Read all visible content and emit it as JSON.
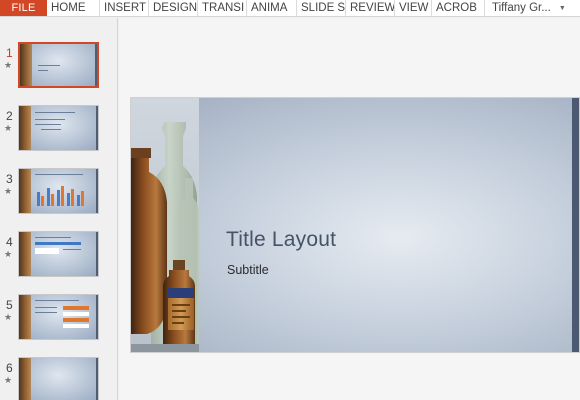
{
  "ribbon": {
    "file_label": "FILE",
    "tabs": [
      "HOME",
      "INSERT",
      "DESIGN",
      "TRANSI",
      "ANIMA",
      "SLIDE S",
      "REVIEW",
      "VIEW",
      "ACROB"
    ],
    "user": "Tiffany Gr...",
    "file_color": "#d24726"
  },
  "thumbnails": [
    {
      "number": "1",
      "star": "★",
      "selected": true
    },
    {
      "number": "2",
      "star": "★",
      "selected": false
    },
    {
      "number": "3",
      "star": "★",
      "selected": false
    },
    {
      "number": "4",
      "star": "★",
      "selected": false
    },
    {
      "number": "5",
      "star": "★",
      "selected": false
    },
    {
      "number": "6",
      "star": "★",
      "selected": false
    }
  ],
  "slide": {
    "title": "Title Layout",
    "subtitle": "Subtitle"
  }
}
